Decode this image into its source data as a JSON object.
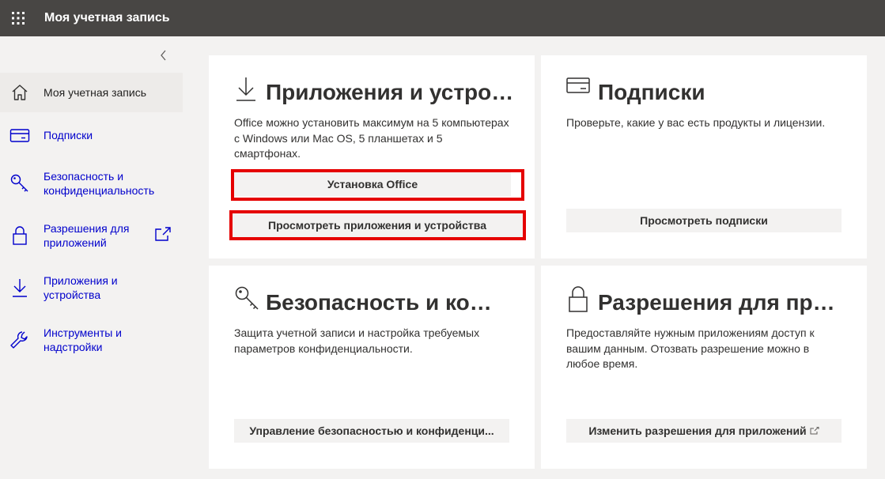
{
  "header": {
    "title": "Моя учетная запись",
    "waffle_icon": "app-launcher-icon",
    "background": "#484644"
  },
  "sidebar": {
    "collapse_icon": "chevron-left-icon",
    "items": [
      {
        "label": "Моя учетная запись",
        "icon": "home-icon",
        "active": true
      },
      {
        "label": "Подписки",
        "icon": "credit-card-icon"
      },
      {
        "label": "Безопасность и конфиденциальность",
        "icon": "key-icon"
      },
      {
        "label": "Разрешения для приложений",
        "icon": "lock-icon",
        "external": true
      },
      {
        "label": "Приложения и устройства",
        "icon": "download-icon"
      },
      {
        "label": "Инструменты и надстройки",
        "icon": "wrench-icon"
      }
    ]
  },
  "cards": {
    "apps": {
      "icon": "download-icon",
      "title": "Приложения и устройства",
      "description": "Office можно установить максимум на 5 компьютерах с Windows или Mac OS, 5 планшетах и 5 смартфонах.",
      "buttons": [
        "Установка Office",
        "Просмотреть приложения и устройства"
      ]
    },
    "subscriptions": {
      "icon": "credit-card-icon",
      "title": "Подписки",
      "description": "Проверьте, какие у вас есть продукты и лицензии.",
      "button": "Просмотреть подписки"
    },
    "security": {
      "icon": "key-icon",
      "title": "Безопасность и конфиденциальность",
      "description": "Защита учетной записи и настройка требуемых параметров конфиденциальности.",
      "button": "Управление безопасностью и конфиденци..."
    },
    "permissions": {
      "icon": "lock-icon",
      "title": "Разрешения для приложений",
      "description": "Предоставляйте нужным приложениям доступ к вашим данным. Отозвать разрешение можно в любое время.",
      "button": "Изменить разрешения для приложений",
      "button_icon": "external-link-icon"
    }
  },
  "colors": {
    "link": "#0000cc",
    "highlight": "#e50000",
    "button_bg": "#f3f2f1"
  }
}
